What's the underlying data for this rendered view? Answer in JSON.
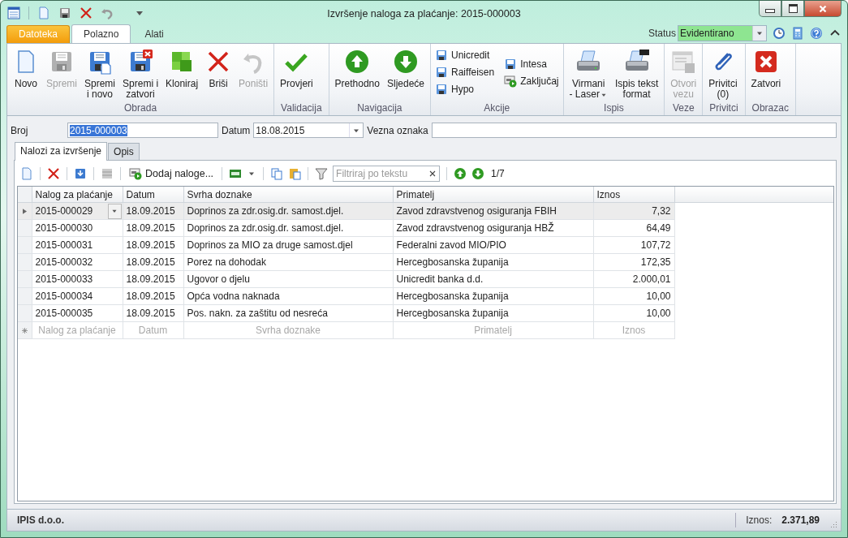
{
  "window": {
    "title": "Izvršenje naloga za plaćanje: 2015-000003"
  },
  "ribbon_tabs": [
    {
      "label": "Datoteka",
      "kind": "file",
      "selected": false
    },
    {
      "label": "Polazno",
      "kind": "tab",
      "selected": true
    },
    {
      "label": "Alati",
      "kind": "tab",
      "selected": false
    }
  ],
  "status": {
    "label": "Status",
    "value": "Evidentirano"
  },
  "ribbon": {
    "groups": [
      {
        "label": "Obrada",
        "kind": "large",
        "items": [
          {
            "label": "Novo",
            "disabled": false
          },
          {
            "label": "Spremi",
            "disabled": true
          },
          {
            "label": "Spremi\ni novo",
            "disabled": false
          },
          {
            "label": "Spremi i\nzatvori",
            "disabled": false
          },
          {
            "label": "Kloniraj",
            "disabled": false
          },
          {
            "label": "Briši",
            "disabled": false
          },
          {
            "label": "Poništi",
            "disabled": true
          }
        ]
      },
      {
        "label": "Validacija",
        "kind": "large",
        "items": [
          {
            "label": "Provjeri",
            "disabled": false
          }
        ]
      },
      {
        "label": "Navigacija",
        "kind": "large",
        "items": [
          {
            "label": "Prethodno",
            "disabled": false
          },
          {
            "label": "Sljedeće",
            "disabled": false
          }
        ]
      },
      {
        "label": "Akcije",
        "kind": "small",
        "columns": [
          [
            {
              "label": "Unicredit"
            },
            {
              "label": "Raiffeisen"
            },
            {
              "label": "Hypo"
            }
          ],
          [
            {
              "label": "Intesa"
            },
            {
              "label": "Zaključaj"
            }
          ]
        ]
      },
      {
        "label": "Ispis",
        "kind": "large",
        "items": [
          {
            "label": "Virmani\n- Laser",
            "disabled": false,
            "dropdown": true
          },
          {
            "label": "Ispis tekst\nformat",
            "disabled": false
          }
        ]
      },
      {
        "label": "Veze",
        "kind": "large",
        "items": [
          {
            "label": "Otvori\nvezu",
            "disabled": true
          }
        ]
      },
      {
        "label": "Privitci",
        "kind": "large",
        "items": [
          {
            "label": "Privitci\n(0)",
            "disabled": false
          }
        ]
      },
      {
        "label": "Obrazac",
        "kind": "large",
        "items": [
          {
            "label": "Zatvori",
            "disabled": false
          }
        ]
      }
    ]
  },
  "form": {
    "broj": {
      "label": "Broj",
      "value": "2015-000003",
      "text_selected": true
    },
    "datum": {
      "label": "Datum",
      "value": "18.08.2015"
    },
    "vezna_oznaka": {
      "label": "Vezna oznaka"
    }
  },
  "tabs": [
    {
      "label": "Nalozi za izvršenje",
      "selected": true
    },
    {
      "label": "Opis",
      "selected": false
    }
  ],
  "toolbar": {
    "add_button": "Dodaj naloge...",
    "filter": {
      "placeholder": "Filtriraj po tekstu"
    },
    "position": "1/7"
  },
  "grid": {
    "columns": [
      "Nalog za plaćanje",
      "Datum",
      "Svrha doznake",
      "Primatelj",
      "Iznos"
    ],
    "rows": [
      {
        "cells": [
          "2015-000029",
          "18.09.2015",
          "Doprinos za zdr.osig.dr. samost.djel.",
          "Zavod zdravstvenog osiguranja FBIH",
          "7,32"
        ],
        "selected": true
      },
      {
        "cells": [
          "2015-000030",
          "18.09.2015",
          "Doprinos za zdr.osig.dr. samost.djel.",
          "Zavod zdravstvenog osiguranja HBŽ",
          "64,49"
        ],
        "selected": false
      },
      {
        "cells": [
          "2015-000031",
          "18.09.2015",
          "Doprinos za MIO za druge samost.djel",
          "Federalni zavod MIO/PIO",
          "107,72"
        ],
        "selected": false
      },
      {
        "cells": [
          "2015-000032",
          "18.09.2015",
          "Porez na dohodak",
          "Hercegbosanska županija",
          "172,35"
        ],
        "selected": false
      },
      {
        "cells": [
          "2015-000033",
          "18.09.2015",
          "Ugovor o djelu",
          "Unicredit banka d.d.",
          "2.000,01"
        ],
        "selected": false
      },
      {
        "cells": [
          "2015-000034",
          "18.09.2015",
          "Opća vodna naknada",
          "Hercegbosanska županija",
          "10,00"
        ],
        "selected": false
      },
      {
        "cells": [
          "2015-000035",
          "18.09.2015",
          "Pos. nakn. za zaštitu od nesreća",
          "Hercegbosanska županija",
          "10,00"
        ],
        "selected": false
      }
    ],
    "new_row_placeholders": [
      "Nalog za plaćanje",
      "Datum",
      "Svrha doznake",
      "Primatelj",
      "Iznos"
    ]
  },
  "status_bar": {
    "company": "IPIS d.o.o.",
    "total_label": "Iznos:",
    "total_value": "2.371,89"
  }
}
